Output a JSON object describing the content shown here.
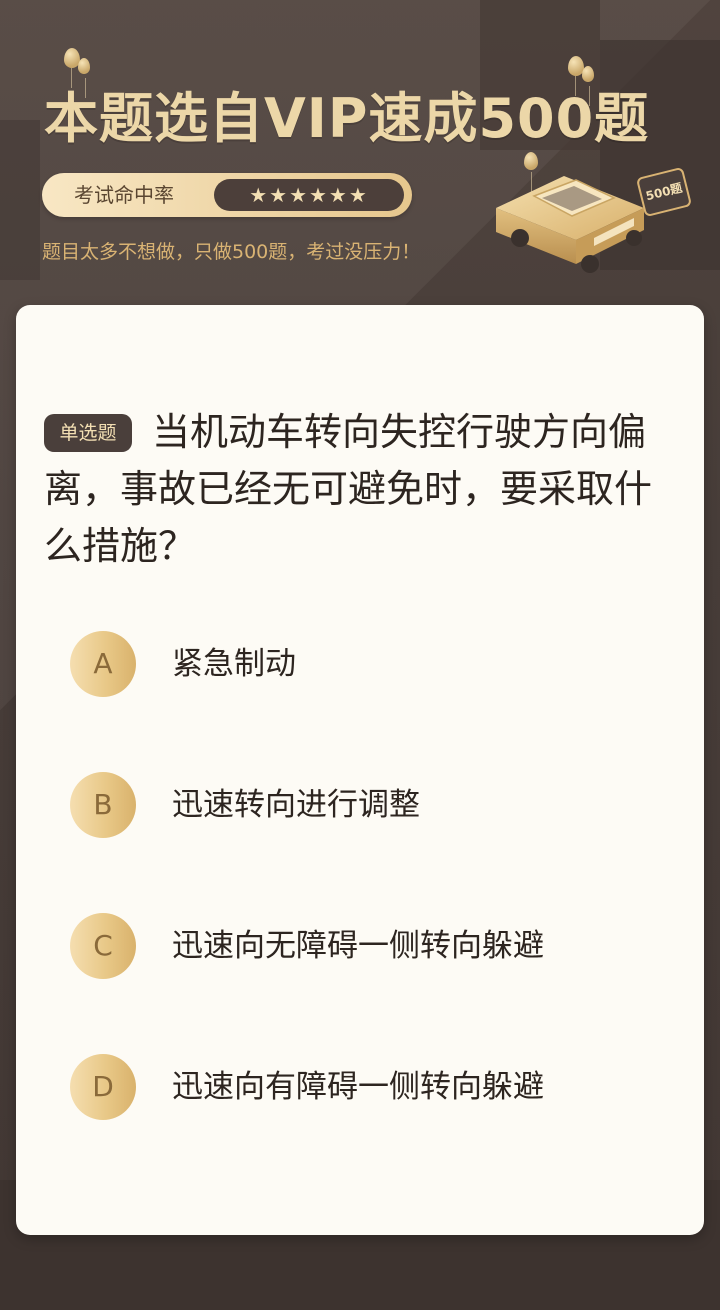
{
  "header": {
    "headline": "本题选自VIP速成500题",
    "rate_label": "考试命中率",
    "rate_stars": "★★★★★★",
    "tagline": "题目太多不想做，只做500题，考过没压力！",
    "car_sign": "500题"
  },
  "question": {
    "type_badge": "单选题",
    "text": "当机动车转向失控行驶方向偏离，事故已经无可避免时，要采取什么措施？"
  },
  "options": [
    {
      "letter": "A",
      "text": "紧急制动"
    },
    {
      "letter": "B",
      "text": "迅速转向进行调整"
    },
    {
      "letter": "C",
      "text": "迅速向无障碍一侧转向躲避"
    },
    {
      "letter": "D",
      "text": "迅速向有障碍一侧转向躲避"
    }
  ],
  "colors": {
    "background": "#4a3f3b",
    "gold": "#ecd7a8",
    "card": "#fdfbf5",
    "text": "#2d2520"
  }
}
